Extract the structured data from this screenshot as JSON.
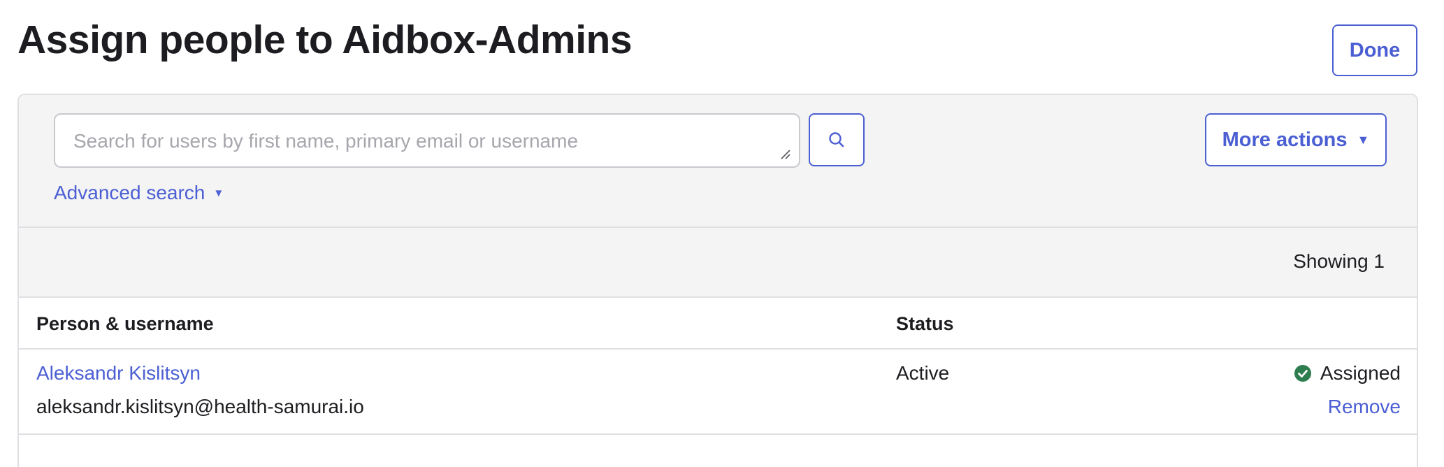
{
  "page": {
    "title": "Assign people to Aidbox-Admins",
    "done_label": "Done"
  },
  "toolbar": {
    "search_placeholder": "Search for users by first name, primary email or username",
    "search_value": "",
    "search_button_icon": "search-icon",
    "more_actions_label": "More actions",
    "more_actions_icon": "caret-down-icon",
    "advanced_search_label": "Advanced search",
    "advanced_search_icon": "caret-down-icon"
  },
  "results": {
    "showing_text": "Showing 1"
  },
  "table": {
    "columns": [
      "Person & username",
      "Status",
      ""
    ],
    "rows": [
      {
        "name": "Aleksandr Kislitsyn",
        "email": "aleksandr.kislitsyn@health-samurai.io",
        "status": "Active",
        "assignment_icon": "check-circle-icon",
        "assignment": "Assigned",
        "action": "Remove"
      }
    ]
  },
  "colors": {
    "accent": "#4b5fd3",
    "success": "#2e7d4f",
    "toolbar_bg": "#f4f4f5",
    "border": "#e0e0e4"
  }
}
